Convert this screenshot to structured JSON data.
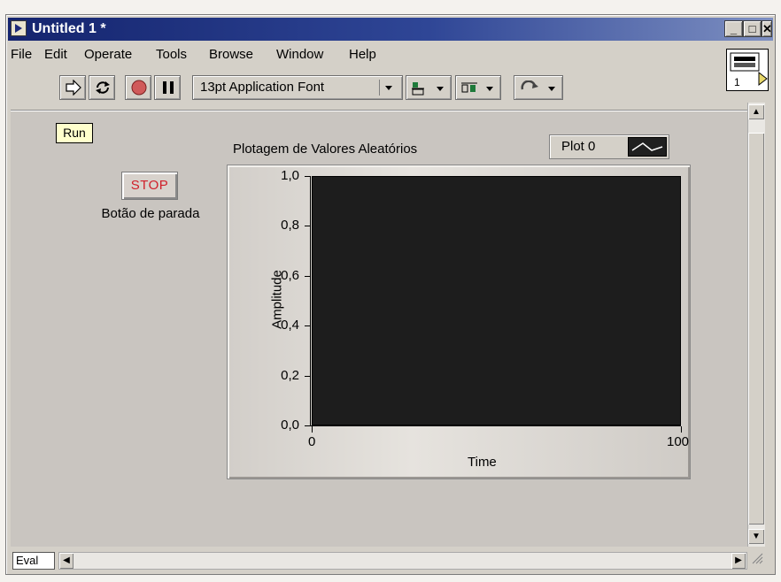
{
  "window": {
    "title": "Untitled 1 *",
    "controls": {
      "minimize": "_",
      "maximize": "□",
      "close": "✕"
    }
  },
  "menubar": {
    "items": [
      "File",
      "Edit",
      "Operate",
      "Tools",
      "Browse",
      "Window",
      "Help"
    ]
  },
  "toolbar": {
    "run_icon": "run-arrow-icon",
    "run_continuously_icon": "run-continuously-icon",
    "abort_icon": "abort-execution-icon",
    "pause_icon": "pause-icon",
    "font_ring_value": "13pt Application Font",
    "align_icon": "align-objects-icon",
    "distribute_icon": "distribute-objects-icon",
    "reorder_icon": "reorder-icon"
  },
  "panel": {
    "run_label": "Run",
    "stop_button_label": "STOP",
    "stop_caption": "Botão de parada",
    "eval_label": "Eval"
  },
  "chart": {
    "title": "Plotagem de Valores Aleatórios",
    "legend_label": "Plot 0",
    "y_ticks": [
      "1,0",
      "0,8",
      "0,6",
      "0,4",
      "0,2",
      "0,0"
    ],
    "x_ticks": [
      "0",
      "100"
    ],
    "xlabel": "Time",
    "ylabel": "Amplitude"
  },
  "chart_data": {
    "type": "line",
    "title": "Plotagem de Valores Aleatórios",
    "xlabel": "Time",
    "ylabel": "Amplitude",
    "xlim": [
      0,
      100
    ],
    "ylim": [
      0.0,
      1.0
    ],
    "series": [
      {
        "name": "Plot 0",
        "values": []
      }
    ],
    "grid": false,
    "legend": "top-right",
    "colors": {
      "plot_background": "#1d1d1d",
      "frame": "#d4d0c8"
    }
  },
  "colors": {
    "titlebar_start": "#14246e",
    "titlebar_end": "#7d8fc1",
    "stop_text": "#d0202a",
    "run_label_bg": "#ffffcc"
  }
}
